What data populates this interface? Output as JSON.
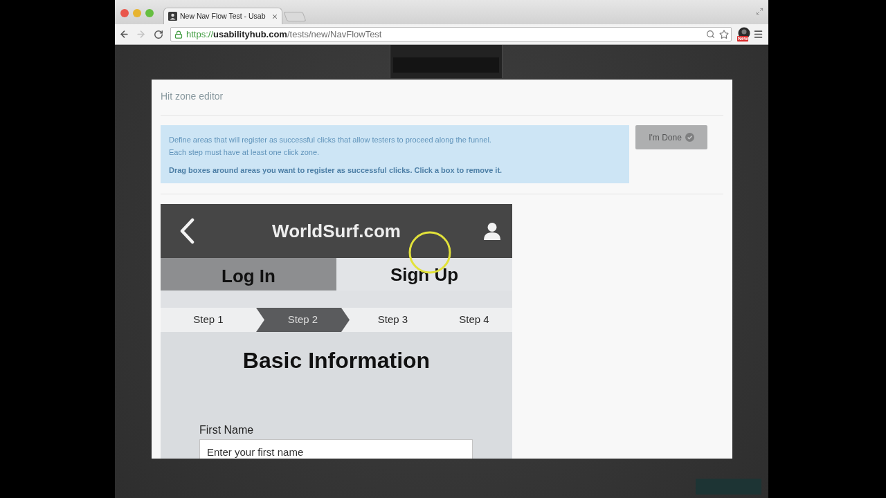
{
  "browser": {
    "tabs": [
      {
        "title": "New Nav Flow Test - Usab",
        "selected": true
      }
    ],
    "toolbar": {
      "back": {
        "disabled": false
      },
      "forward": {
        "disabled": true
      }
    },
    "address": {
      "secure": true,
      "scheme": "https://",
      "host": "usabilityhub.com",
      "path": "/tests/new/NavFlowTest"
    },
    "extension_badge": "New"
  },
  "dialog": {
    "title": "Hit zone editor",
    "notice": [
      {
        "text": "Define areas that will register as successful clicks that allow testers to proceed along the funnel.",
        "bold": false
      },
      {
        "text": "Each step must have at least one click zone.",
        "bold": false
      },
      {
        "text": "Drag boxes around areas you want to register as successful clicks. Click a box to remove it.",
        "bold": true
      }
    ],
    "done_button": {
      "label": "I'm Done",
      "disabled": true
    }
  },
  "mockup": {
    "site_title": "WorldSurf.com",
    "tabs": [
      {
        "label": "Log In",
        "selected": false
      },
      {
        "label": "Sign Up",
        "selected": true
      }
    ],
    "steps": [
      {
        "label": "Step 1",
        "selected": false
      },
      {
        "label": "Step 2",
        "selected": true
      },
      {
        "label": "Step 3",
        "selected": false
      },
      {
        "label": "Step 4",
        "selected": false
      }
    ],
    "heading": "Basic Information",
    "fields": [
      {
        "label": "First Name",
        "placeholder": "Enter your first name"
      }
    ]
  }
}
